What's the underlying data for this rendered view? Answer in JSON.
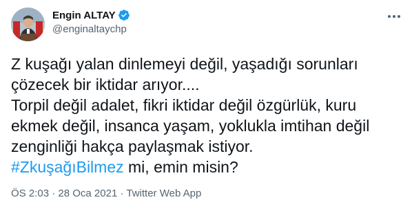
{
  "tweet": {
    "author_name": "Engin ALTAY",
    "handle": "@enginaltaychp",
    "text_lines": [
      "Z kuşağı yalan dinlemeyi değil, yaşadığı sorunları",
      "çözecek bir iktidar arıyor....",
      "Torpil değil adalet, fikri iktidar değil özgürlük, kuru",
      "ekmek değil, insanca yaşam, yoklukla imtihan değil",
      "zenginliği hakça paylaşmak istiyor."
    ],
    "hashtag": "#ZkuşağıBilmez",
    "last_line_suffix": " mi, emin misin?",
    "time": "ÖS 2:03",
    "separator": "·",
    "date": "28 Oca 2021",
    "source": "Twitter Web App"
  },
  "icons": {
    "verified": "verified-badge-icon",
    "more": "more-options-icon",
    "avatar": "profile-photo"
  },
  "colors": {
    "accent": "#1d9bf0",
    "text": "#0f1419",
    "secondary": "#536471"
  }
}
